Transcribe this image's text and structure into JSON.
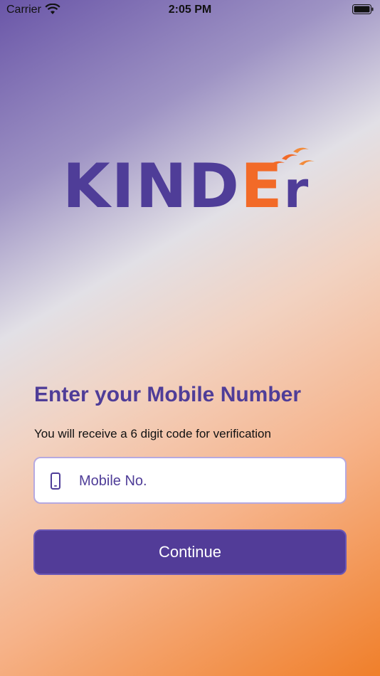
{
  "status_bar": {
    "carrier": "Carrier",
    "time": "2:05 PM"
  },
  "logo": {
    "brand": "KINDEr"
  },
  "login": {
    "heading": "Enter your Mobile Number",
    "subtext": "You will receive a 6 digit code for verification",
    "mobile_placeholder": "Mobile No.",
    "continue_label": "Continue"
  },
  "colors": {
    "primary": "#523c98",
    "accent": "#f26a28"
  }
}
